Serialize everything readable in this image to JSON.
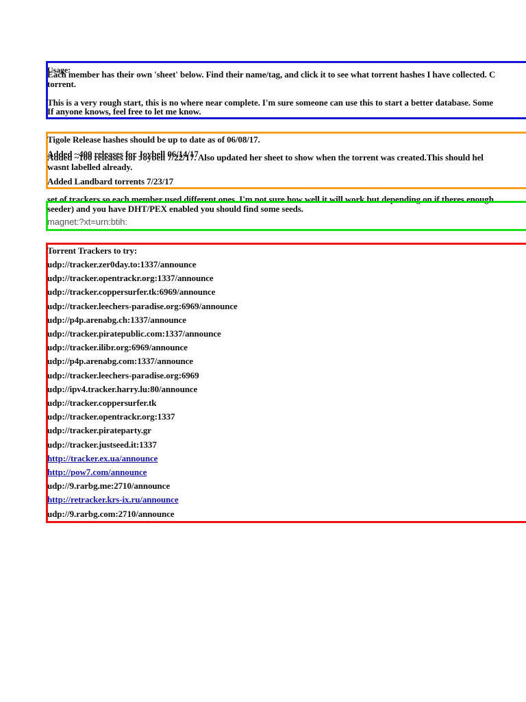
{
  "usage": {
    "label": "Usage:",
    "line1": "Each member has their own 'sheet' below. Find their name/tag, and click it to see what torrent hashes I have collected. C",
    "line2": "torrent.",
    "line3": "This is a very rough start, this is no where near complete. I'm sure someone can use this to start a better database. Some",
    "line4": "If anyone knows, feel free to let me know."
  },
  "updates": {
    "line1": "Tigole Release hashes should be up to date as of 06/08/17.",
    "line2a": "Added ~400 releases for Joybell 06/14/17",
    "line2b": "Added ~100 releases for Joybell 7/22/17. Also updated her sheet to show when the torrent was created.This should hel",
    "line3": "wasnt labelled already.",
    "line4": "Added Landbard torrents 7/23/17"
  },
  "magnet": {
    "line1": "set of trackers so each member used different ones. I'm not sure how well it will work but depending on if theres enough",
    "line2": "seeder) and you have DHT/PEX enabled you should find some seeds.",
    "prefix": "magnet:?xt=urn:btih:"
  },
  "trackers": {
    "heading": "Torrent Trackers to try:",
    "items": [
      {
        "url": "udp://tracker.zer0day.to:1337/announce",
        "link": false
      },
      {
        "url": "udp://tracker.opentrackr.org:1337/announce",
        "link": false
      },
      {
        "url": "udp://tracker.coppersurfer.tk:6969/announce",
        "link": false
      },
      {
        "url": "udp://tracker.leechers-paradise.org:6969/announce",
        "link": false
      },
      {
        "url": "udp://p4p.arenabg.ch:1337/announce",
        "link": false
      },
      {
        "url": "udp://tracker.piratepublic.com:1337/announce",
        "link": false
      },
      {
        "url": "udp://tracker.ilibr.org:6969/announce",
        "link": false
      },
      {
        "url": "udp://p4p.arenabg.com:1337/announce",
        "link": false
      },
      {
        "url": "udp://tracker.leechers-paradise.org:6969",
        "link": false
      },
      {
        "url": "udp://ipv4.tracker.harry.lu:80/announce",
        "link": false
      },
      {
        "url": "udp://tracker.coppersurfer.tk",
        "link": false
      },
      {
        "url": "udp://tracker.opentrackr.org:1337",
        "link": false
      },
      {
        "url": "udp://tracker.pirateparty.gr",
        "link": false
      },
      {
        "url": "udp://tracker.justseed.it:1337",
        "link": false
      },
      {
        "url": "http://tracker.ex.ua/announce",
        "link": true
      },
      {
        "url": "http://pow7.com/announce",
        "link": true
      },
      {
        "url": "udp://9.rarbg.me:2710/announce",
        "link": false
      },
      {
        "url": "http://retracker.krs-ix.ru/announce",
        "link": true
      },
      {
        "url": "udp://9.rarbg.com:2710/announce",
        "link": false
      }
    ]
  },
  "colors": {
    "blue": "#1515d6",
    "orange": "#f5a020",
    "green": "#19e019",
    "red": "#e81515",
    "link": "#1a1a9a"
  }
}
